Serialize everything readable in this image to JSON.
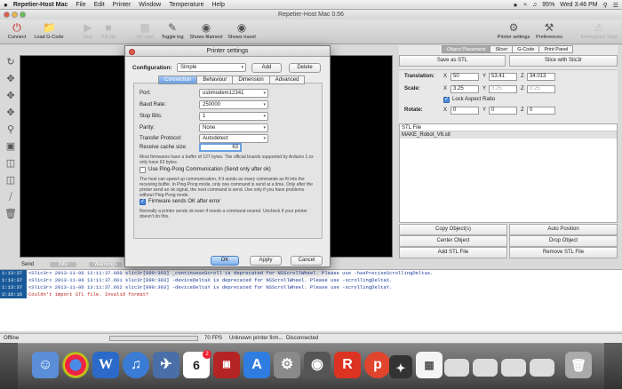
{
  "menubar": {
    "apple": "",
    "items": [
      "Repetier-Host Mac",
      "File",
      "Edit",
      "Printer",
      "Window",
      "Temperature",
      "Help"
    ],
    "battery": "95%",
    "clock": "Wed 3:46 PM"
  },
  "window": {
    "title": "Repetier-Host Mac 0.56"
  },
  "toolbar": {
    "connect": "Connect",
    "load_gcode": "Load G-Code",
    "run": "Run",
    "kill_job": "Kill job",
    "sd_card": "SD card",
    "toggle_log": "Toggle log",
    "shows_filament": "Shows filament",
    "shows_travel": "Shows travel",
    "printer_settings": "Printer settings",
    "preferences": "Preferences",
    "emergency_stop": "Emergency Stop"
  },
  "right_panel": {
    "tabs": [
      "Object Placement",
      "Slicer",
      "G-Code",
      "Print Panel"
    ],
    "save_as_stl": "Save as STL",
    "slice_with": "Slice with Slic3r",
    "translation_label": "Translation:",
    "x_label": "X",
    "y_label": "Y",
    "z_label": "Z",
    "translation": {
      "x": "50",
      "y": "53.41",
      "z": "34.013"
    },
    "scale_label": "Scale:",
    "scale": {
      "x": "3.25",
      "y": "3.25",
      "z": "3.25"
    },
    "lock_aspect": "Lock Aspect Ratio",
    "rotate_label": "Rotate:",
    "rotate": {
      "x": "0",
      "y": "0",
      "z": "0"
    },
    "stl_file_header": "STL File",
    "stl_files": [
      "MAKE_Robot_V6.stl"
    ],
    "copy_objects": "Copy Object(s)",
    "auto_position": "Auto Position",
    "center_object": "Center Object",
    "drop_object": "Drop Object",
    "add_stl": "Add STL File",
    "remove_stl": "Remove STL File"
  },
  "dialog": {
    "title": "Printer settings",
    "configuration_label": "Configuration:",
    "configuration_value": "Simple",
    "add": "Add",
    "delete": "Delete",
    "tabs": [
      "Connection",
      "Behaviour",
      "Dimension",
      "Advanced"
    ],
    "port_label": "Port:",
    "port_value": "usbmodem12341",
    "baud_label": "Baud Rate:",
    "baud_value": "250000",
    "stop_bits_label": "Stop Bits:",
    "stop_bits_value": "1",
    "parity_label": "Parity:",
    "parity_value": "None",
    "protocol_label": "Transfer Protocol:",
    "protocol_value": "Autodetect",
    "cache_label": "Receive cache size:",
    "cache_value": "63",
    "cache_note": "Most firmwares have a buffer of 127 bytes. The official boards supported by Arduino 1.xx only have 63 bytes.",
    "ping_pong_label": "Use Ping-Pong Communication (Send only after ok)",
    "ping_pong_note": "The host can speed up communication, if it sends as many commands as fit into the receiving buffer. In Ping-Pong mode, only one command is send at a time. Only after the printer send an ok signal, the next command is send. Use only if you have problems without Ping-Pong mode.",
    "firmware_error_label": "Firmware sends OK after error",
    "firmware_error_note": "Normally a printer sends ok even if needs a command resend. Uncheck if your printer doesn't do this.",
    "ok": "OK",
    "apply": "Apply",
    "cancel": "Cancel"
  },
  "log": {
    "tabs": [
      "Send",
      "Info",
      "Warnings"
    ],
    "lines": [
      {
        "time": "1:13:37",
        "text": "<Slic3r> 2013-11-06 13:11:37.660 slic3r[890:303] _continuousScroll is deprecated for NSScrollWheel. Please use -hasPreciseScrollingDeltas."
      },
      {
        "time": "1:13:37",
        "text": "<Slic3r> 2013-11-06 13:11:37.661 slic3r[890:303] -deviceDeltaX is deprecated for NSScrollWheel. Please use -scrollingDeltaX."
      },
      {
        "time": "1:13:37",
        "text": "<Slic3r> 2013-11-06 13:11:37.662 slic3r[890:303] -deviceDeltaY is deprecated for NSScrollWheel. Please use -scrollingDeltaY."
      },
      {
        "time": "3:16:16",
        "text": "Couldn't import STL file. Invalid format?"
      }
    ]
  },
  "status": {
    "connection": "Offline",
    "fps": "70 FPS",
    "firmware": "Unknown printer firm...",
    "state": "Disconnected"
  },
  "dock": {
    "calendar_day": "6",
    "calendar_badge": "2"
  }
}
